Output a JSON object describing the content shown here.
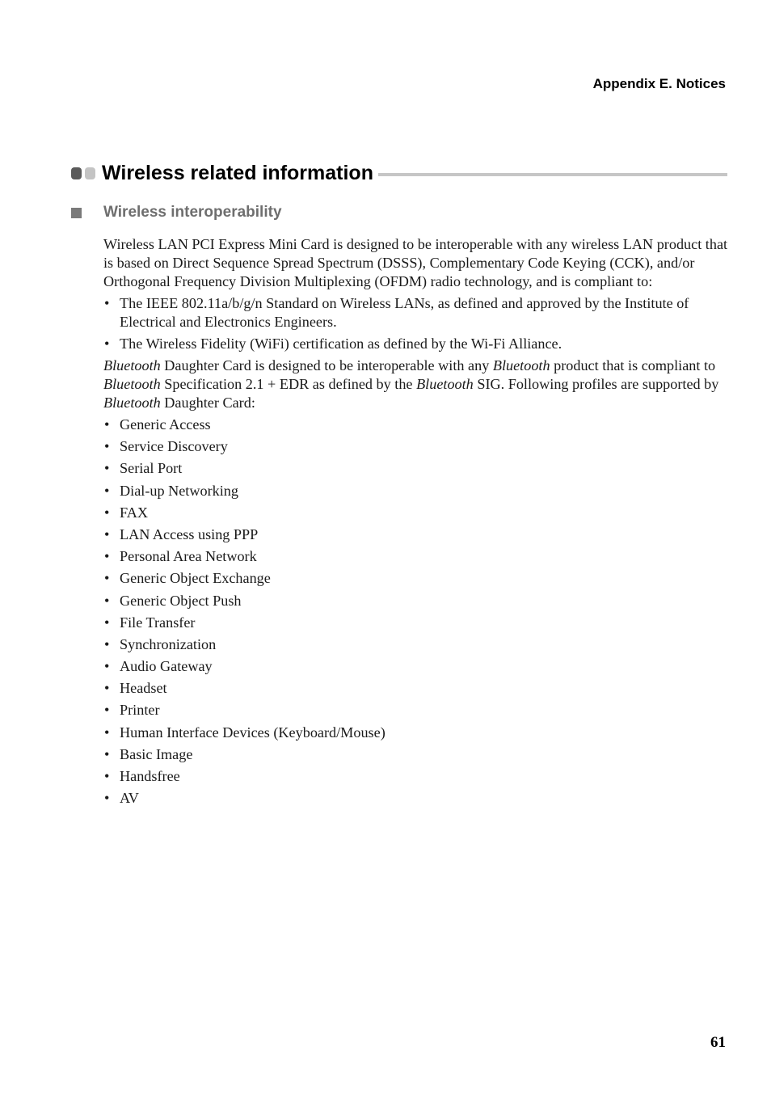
{
  "header": {
    "running_head": "Appendix E. Notices"
  },
  "section": {
    "title": "Wireless related information",
    "subsection": {
      "title": "Wireless interoperability",
      "paragraph1": "Wireless LAN PCI Express Mini Card is designed to be interoperable with any wireless LAN product that is based on Direct Sequence Spread Spectrum (DSSS), Complementary Code Keying (CCK), and/or Orthogonal Frequency Division Multiplexing (OFDM) radio technology, and is compliant to:",
      "compliance_items": [
        "The IEEE 802.11a/b/g/n Standard on Wireless LANs, as defined and approved by the Institute of Electrical and Electronics Engineers.",
        "The Wireless Fidelity (WiFi) certification as defined by the Wi-Fi Alliance."
      ],
      "paragraph2": {
        "bt": "Bluetooth",
        "s1": " Daughter Card is designed to be interoperable with any ",
        "s2": " product that is compliant to ",
        "s3": " Specification 2.1 + EDR as defined by the ",
        "s4": " SIG. Following profiles are supported by ",
        "s5": " Daughter Card:"
      },
      "profiles": [
        "Generic Access",
        "Service Discovery",
        "Serial Port",
        "Dial-up Networking",
        "FAX",
        "LAN Access using PPP",
        "Personal Area Network",
        "Generic Object Exchange",
        "Generic Object Push",
        "File Transfer",
        "Synchronization",
        "Audio Gateway",
        "Headset",
        "Printer",
        "Human Interface Devices (Keyboard/Mouse)",
        "Basic Image",
        "Handsfree",
        "AV"
      ]
    }
  },
  "footer": {
    "page_number": "61"
  },
  "colors": {
    "dot_dark": "#5a5a5a",
    "dot_light": "#c4c4c4",
    "rule": "#c6c6c6",
    "subhead": "#6e6e6e"
  }
}
